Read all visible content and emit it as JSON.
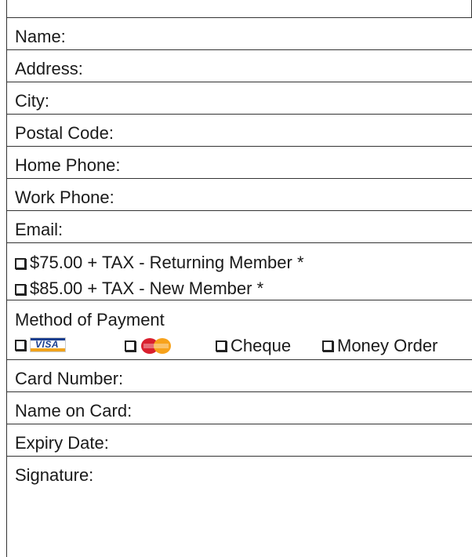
{
  "fields": [
    {
      "label": "Name:"
    },
    {
      "label": "Address:"
    },
    {
      "label": "City:"
    },
    {
      "label": "Postal Code:"
    },
    {
      "label": "Home Phone:"
    },
    {
      "label": "Work Phone:"
    },
    {
      "label": "Email:"
    }
  ],
  "membership": {
    "option1": "$75.00 + TAX - Returning Member *",
    "option2": "$85.00 + TAX - New Member *"
  },
  "payment": {
    "title": "Method of Payment",
    "visa_text": "VISA",
    "mastercard_logo": "mastercard-logo",
    "cheque": "Cheque",
    "money_order": "Money Order"
  },
  "card_fields": [
    {
      "label": "Card Number:"
    },
    {
      "label": "Name on Card:"
    },
    {
      "label": "Expiry Date:"
    },
    {
      "label": "Signature:"
    }
  ]
}
